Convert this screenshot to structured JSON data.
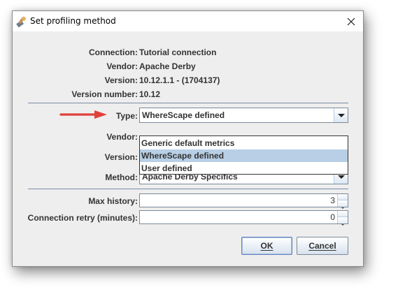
{
  "window": {
    "title": "Set profiling method"
  },
  "info": {
    "connection_label": "Connection:",
    "connection_value": "Tutorial connection",
    "vendor_label": "Vendor:",
    "vendor_value": "Apache Derby",
    "version_label": "Version:",
    "version_value": "10.12.1.1 - (1704137)",
    "version_number_label": "Version number:",
    "version_number_value": "10.12"
  },
  "method_section": {
    "type_label": "Type:",
    "type_selected": "WhereScape defined",
    "type_options": [
      "Generic default metrics",
      "WhereScape defined",
      "User defined"
    ],
    "type_highlighted_index": 1,
    "vendor_label": "Vendor:",
    "version_label": "Version:",
    "method_label": "Method:",
    "method_selected": "Apache Derby Specifics"
  },
  "settings": {
    "max_history_label": "Max history:",
    "max_history_value": "3",
    "connection_retry_label": "Connection retry (minutes):",
    "connection_retry_value": "0"
  },
  "buttons": {
    "ok_label": "OK",
    "cancel_label": "Cancel"
  },
  "colors": {
    "annotation_arrow": "#e0403a",
    "selection_highlight": "#b8cfe5",
    "dialog_background": "#eeeeee"
  }
}
